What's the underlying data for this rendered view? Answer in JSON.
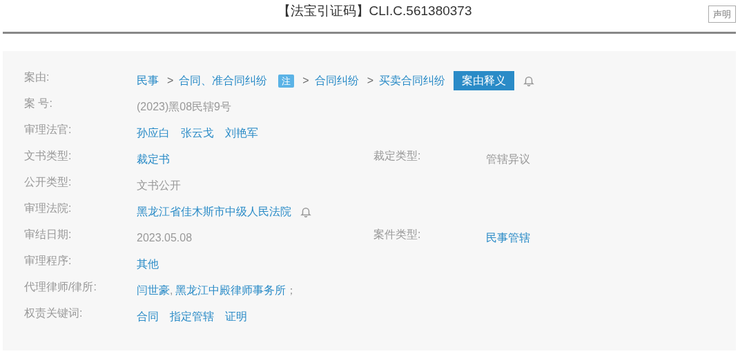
{
  "header": {
    "title": "【法宝引证码】CLI.C.561380373",
    "notice_button": "声明"
  },
  "fields": [
    {
      "label": "案由:",
      "bell": true,
      "values": [
        {
          "kind": "link",
          "text": "民事"
        },
        {
          "kind": "separator",
          "text": ">"
        },
        {
          "kind": "link",
          "text": "合同、准合同纠纷"
        },
        {
          "kind": "badge",
          "text": "注"
        },
        {
          "kind": "separator",
          "text": ">"
        },
        {
          "kind": "link",
          "text": "合同纠纷"
        },
        {
          "kind": "separator",
          "text": ">"
        },
        {
          "kind": "link",
          "text": "买卖合同纠纷"
        },
        {
          "kind": "button",
          "text": "案由释义"
        }
      ]
    },
    {
      "label": "案 号:",
      "bell": false,
      "values": [
        {
          "kind": "plain",
          "text": "(2023)黑08民辖9号"
        }
      ]
    },
    {
      "label": "审理法官:",
      "bell": false,
      "values": [
        {
          "kind": "link",
          "text": "孙应白"
        },
        {
          "kind": "link",
          "text": "张云戈"
        },
        {
          "kind": "link",
          "text": "刘艳军"
        }
      ]
    },
    {
      "label": "文书类型:",
      "bell": false,
      "values": [
        {
          "kind": "link",
          "text": "裁定书"
        }
      ],
      "extra": {
        "label": "裁定类型:",
        "value": {
          "kind": "plain",
          "text": "管辖异议"
        }
      }
    },
    {
      "label": "公开类型:",
      "bell": false,
      "values": [
        {
          "kind": "plain",
          "text": "文书公开"
        }
      ]
    },
    {
      "label": "审理法院:",
      "bell": true,
      "values": [
        {
          "kind": "link",
          "text": "黑龙江省佳木斯市中级人民法院"
        }
      ]
    },
    {
      "label": "审结日期:",
      "bell": false,
      "values": [
        {
          "kind": "plain",
          "text": "2023.05.08"
        }
      ],
      "extra": {
        "label": "案件类型:",
        "value": {
          "kind": "link",
          "text": "民事管辖"
        }
      }
    },
    {
      "label": "审理程序:",
      "bell": false,
      "values": [
        {
          "kind": "link",
          "text": "其他"
        }
      ]
    },
    {
      "label": "代理律师/律所:",
      "bell": false,
      "values": [
        {
          "kind": "link",
          "text": "闫世豪"
        },
        {
          "kind": "punct",
          "text": ","
        },
        {
          "kind": "link",
          "text": "黑龙江中殿律师事务所"
        },
        {
          "kind": "punct",
          "text": "；"
        }
      ]
    },
    {
      "label": "权责关键词:",
      "bell": false,
      "values": [
        {
          "kind": "link",
          "text": "合同"
        },
        {
          "kind": "link",
          "text": "指定管辖"
        },
        {
          "kind": "link",
          "text": "证明"
        }
      ]
    }
  ]
}
